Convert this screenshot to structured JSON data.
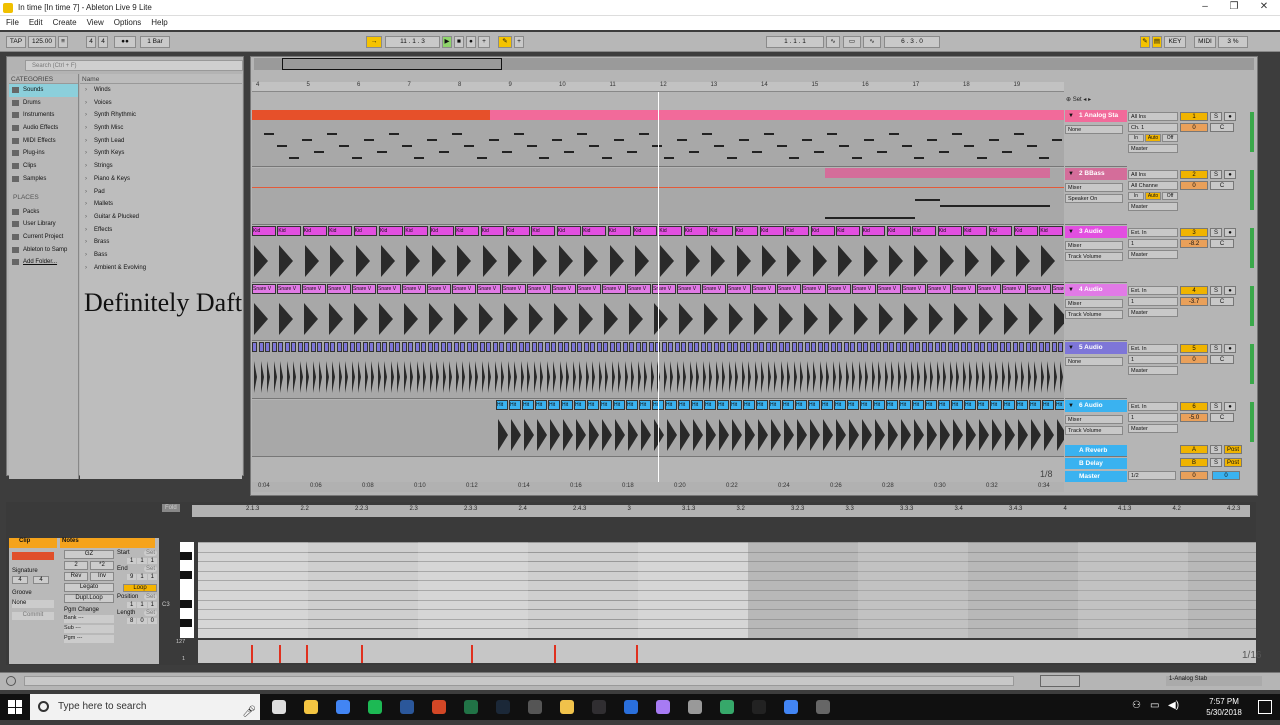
{
  "window": {
    "title": "In time  [In time 7] - Ableton Live 9 Lite",
    "controls": [
      "–",
      "❐",
      "✕"
    ]
  },
  "menu": [
    "File",
    "Edit",
    "Create",
    "View",
    "Options",
    "Help"
  ],
  "control_bar": {
    "tap": "TAP",
    "tempo": "125.00",
    "sig_num": "4",
    "sig_den": "4",
    "quantize": "1 Bar",
    "position": "11 . 1 . 3",
    "loop_start": "1 . 1 . 1",
    "loop_length": "6 . 3 . 0",
    "key": "KEY",
    "midi": "MIDI",
    "cpu": "3 %"
  },
  "browser": {
    "search_placeholder": "Search (Ctrl + F)",
    "categories_label": "CATEGORIES",
    "name_label": "Name",
    "categories": [
      "Sounds",
      "Drums",
      "Instruments",
      "Audio Effects",
      "MIDI Effects",
      "Plug-ins",
      "Clips",
      "Samples"
    ],
    "places_label": "PLACES",
    "places": [
      "Packs",
      "User Library",
      "Current Project",
      "Ableton to Samp",
      "Add Folder..."
    ],
    "items": [
      "Winds",
      "Voices",
      "Synth Rhythmic",
      "Synth Misc",
      "Synth Lead",
      "Synth Keys",
      "Strings",
      "Piano & Keys",
      "Pad",
      "Mallets",
      "Guitar & Plucked",
      "Effects",
      "Brass",
      "Bass",
      "Ambient & Evolving"
    ]
  },
  "watermark": "Definitely Daft",
  "ruler": [
    "4",
    "5",
    "6",
    "7",
    "8",
    "9",
    "10",
    "11",
    "12",
    "13",
    "14",
    "15",
    "16",
    "17",
    "18",
    "19"
  ],
  "timeline": [
    "0:04",
    "0:06",
    "0:08",
    "0:10",
    "0:12",
    "0:14",
    "0:16",
    "0:18",
    "0:20",
    "0:22",
    "0:24",
    "0:26",
    "0:28",
    "0:30",
    "0:32",
    "0:34"
  ],
  "set_label": "Set",
  "tracks": [
    {
      "name": "1 Analog Sta",
      "color": "#f26a9a",
      "input": "All Ins",
      "channel": "Ch. 1",
      "monitor": [
        "In",
        "Auto",
        "Off"
      ],
      "out": "Master",
      "sel1": "None",
      "num": "1",
      "vol": "0",
      "pan": "C"
    },
    {
      "name": "2 BBass",
      "color": "#d46d9a",
      "input": "All Ins",
      "channel": "All Channe",
      "monitor": [
        "In",
        "Auto",
        "Off"
      ],
      "out": "Master",
      "sel1": "Mixer",
      "sel2": "Speaker On",
      "num": "2",
      "vol": "0",
      "pan": "C"
    },
    {
      "name": "3 Audio",
      "color": "#e24fe0",
      "input": "Ext. In",
      "channel": "1",
      "out": "Master",
      "sel1": "Mixer",
      "sel2": "Track Volume",
      "num": "3",
      "vol": "-8.2",
      "pan": "C"
    },
    {
      "name": "4 Audio",
      "color": "#e17ae6",
      "input": "Ext. In",
      "channel": "1",
      "out": "Master",
      "sel1": "Mixer",
      "sel2": "Track Volume",
      "num": "4",
      "vol": "-3.7",
      "pan": "C"
    },
    {
      "name": "5 Audio",
      "color": "#7e76d8",
      "input": "Ext. In",
      "channel": "1",
      "out": "Master",
      "sel1": "None",
      "num": "5",
      "vol": "0",
      "pan": "C"
    },
    {
      "name": "6 Audio",
      "color": "#3ab2f0",
      "input": "Ext. In",
      "channel": "1",
      "out": "Master",
      "sel1": "Mixer",
      "sel2": "Track Volume",
      "num": "6",
      "vol": "-5.0",
      "pan": "C"
    }
  ],
  "returns": [
    {
      "name": "A Reverb",
      "letter": "A",
      "post": "Post"
    },
    {
      "name": "B Delay",
      "letter": "B",
      "post": "Post"
    },
    {
      "name": "Master",
      "routing": "1/2",
      "vol": "0",
      "pan": "0"
    }
  ],
  "clip_labels": {
    "kick": "Kid",
    "snare": "Snare V",
    "hihat": "Hit"
  },
  "grid_fraction": "1/8",
  "detail": {
    "fold": "Fold",
    "clip_title": "Clip",
    "notes_title": "Notes",
    "signature_label": "Signature",
    "sig_num": "4",
    "sig_den": "4",
    "groove_label": "Groove",
    "groove_value": "None",
    "commit": "Commit",
    "pgm_change": "Pgm Change",
    "bank": "Bank ---",
    "sub": "Sub ---",
    "pgm": "Pgm ---",
    "buttons": [
      "GZ",
      "2",
      "*2",
      "Rev",
      "Inv",
      "Legato",
      "Dupl.Loop"
    ],
    "start_label": "Start",
    "end_label": "End",
    "loop": "Loop",
    "position_label": "Position",
    "length_label": "Length",
    "set": "Set",
    "start": [
      "1",
      "1",
      "1"
    ],
    "end": [
      "9",
      "1",
      "1"
    ],
    "position": [
      "1",
      "1",
      "1"
    ],
    "length": [
      "8",
      "0",
      "0"
    ],
    "ruler": [
      "2.1.3",
      "2.2",
      "2.2.3",
      "2.3",
      "2.3.3",
      "2.4",
      "2.4.3",
      "3",
      "3.1.3",
      "3.2",
      "3.2.3",
      "3.3",
      "3.3.3",
      "3.4",
      "3.4.3",
      "4",
      "4.1.3",
      "4.2",
      "4.2.3"
    ],
    "c3": "C3",
    "vel_max": "127",
    "vel_min": "1",
    "grid": "1/16"
  },
  "status": {
    "track": "1-Analog Stab"
  },
  "taskbar": {
    "search": "Type here to search",
    "time": "7:57 PM",
    "date": "5/30/2018",
    "tray_icons": [
      "person-icon",
      "network-icon",
      "volume-icon",
      "notifications-icon"
    ],
    "app_icons": [
      "task-view-icon",
      "file-explorer-icon",
      "chrome-icon",
      "spotify-icon",
      "word-icon",
      "powerpoint-icon",
      "excel-icon",
      "steam-icon",
      "app-icon",
      "folder-icon",
      "obs-icon",
      "app-icon",
      "brush-icon",
      "app-icon",
      "app-icon",
      "epic-games-icon",
      "chrome-icon",
      "app-icon"
    ],
    "app_colors": [
      "#dddddd",
      "#f4c542",
      "#4285f4",
      "#1db954",
      "#2b579a",
      "#d24726",
      "#217346",
      "#1b2838",
      "#555555",
      "#f0c24b",
      "#302e31",
      "#2a6fdb",
      "#a77bf3",
      "#999999",
      "#36a86a",
      "#222222",
      "#4285f4",
      "#666666"
    ]
  }
}
